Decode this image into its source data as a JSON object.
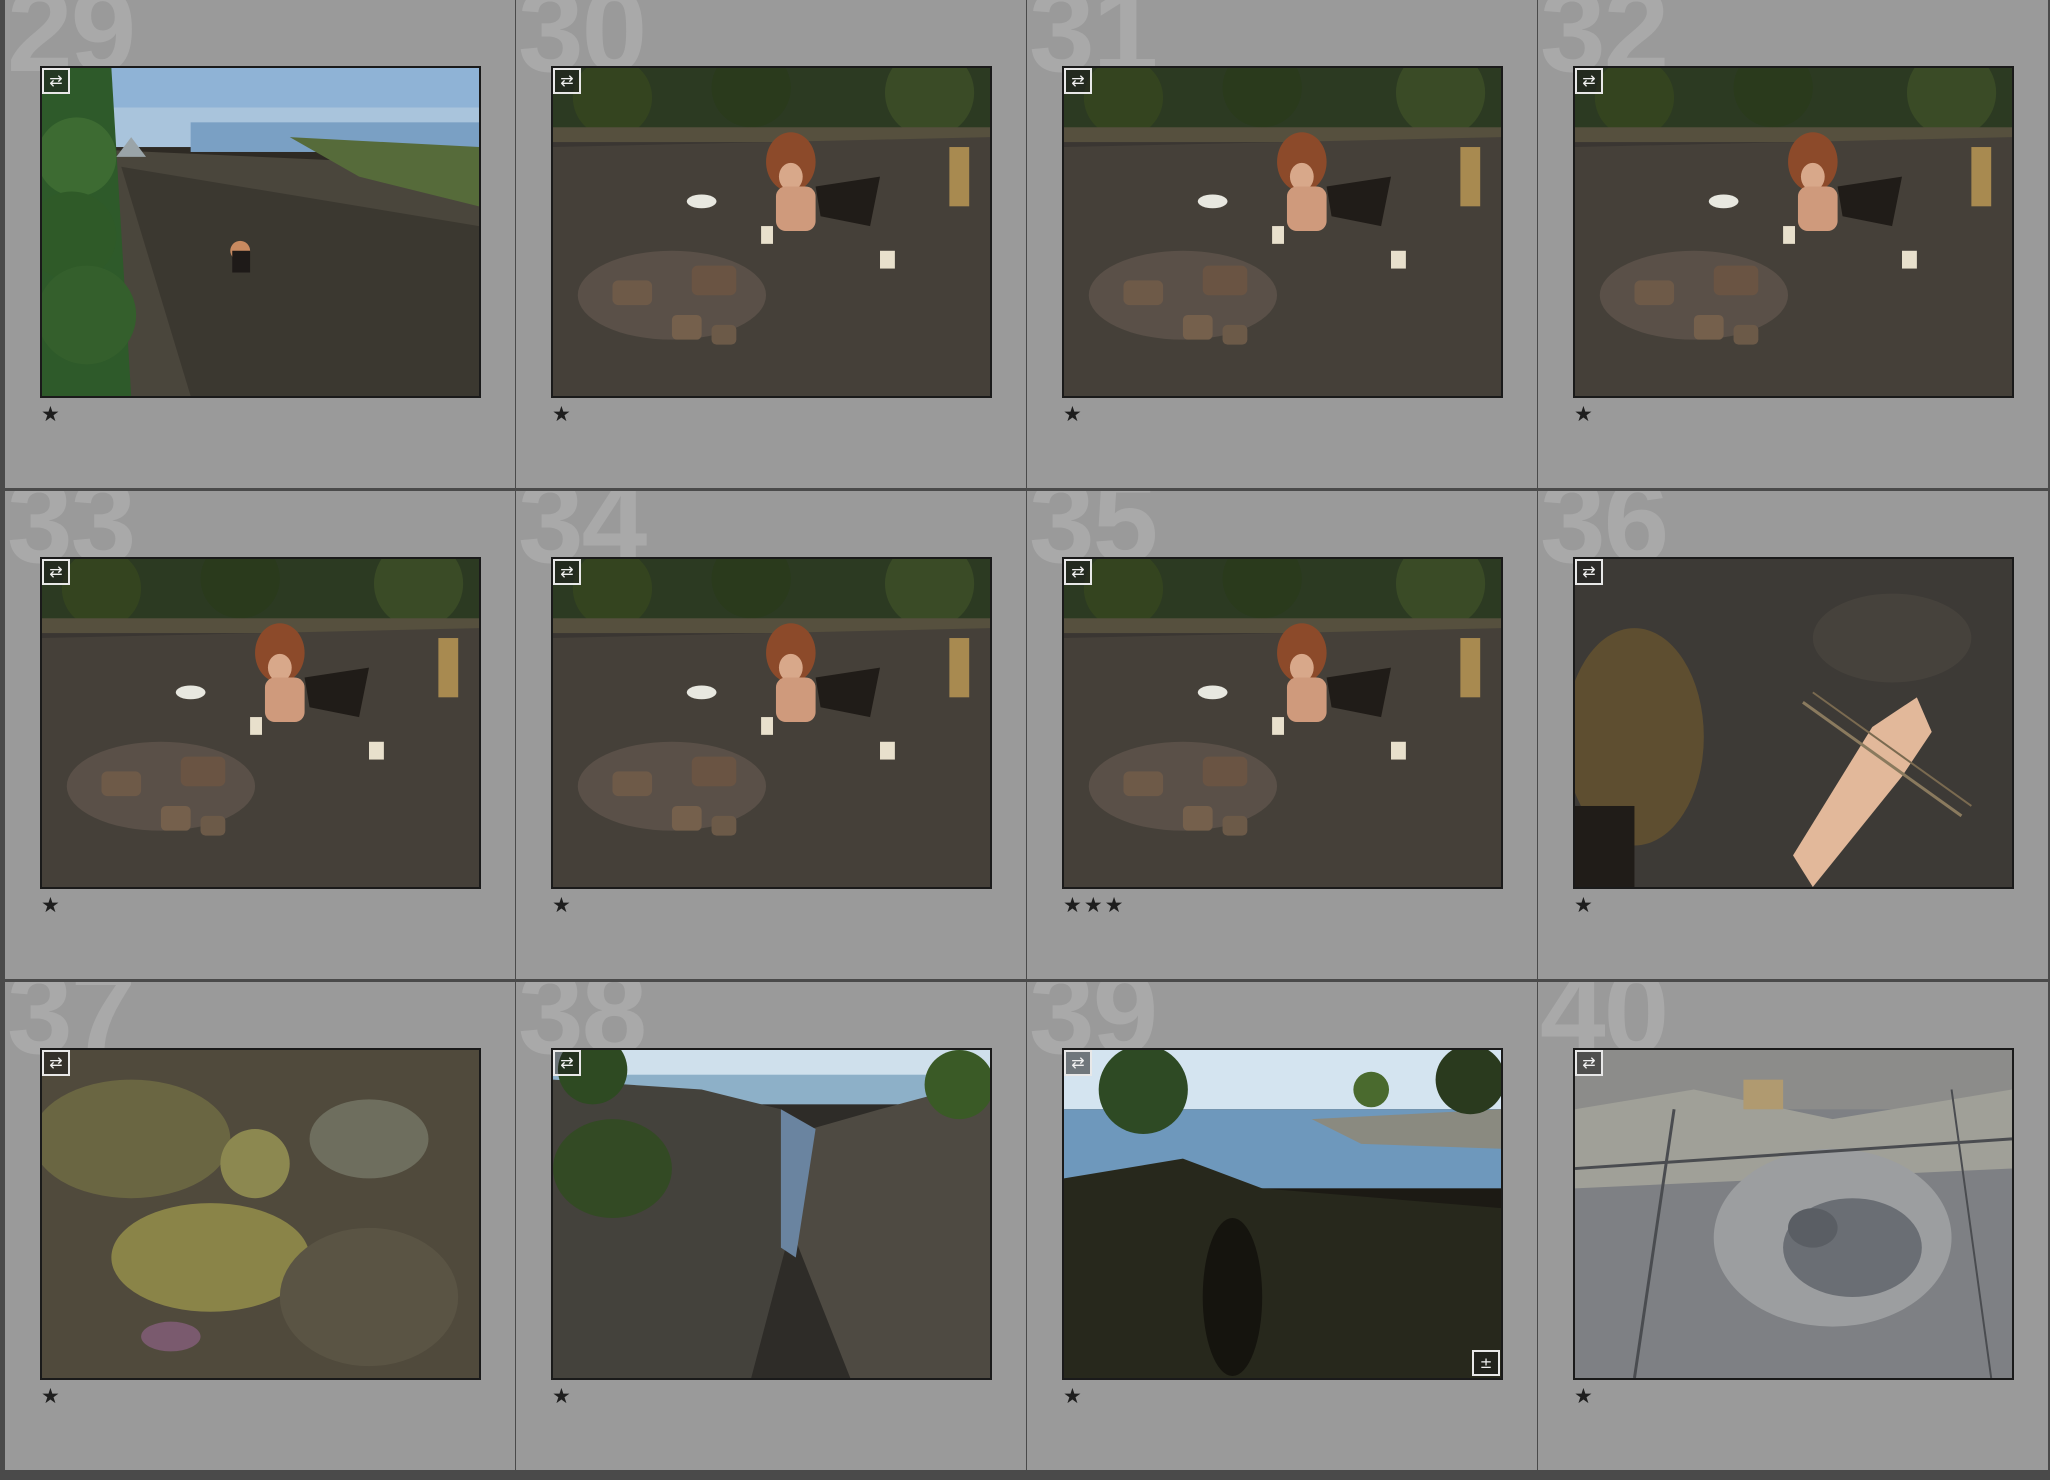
{
  "grid": {
    "cells": [
      {
        "number": "29",
        "rating": "★",
        "sync_icon": "sync-settings-icon",
        "scene": "camp",
        "adjusted": false
      },
      {
        "number": "30",
        "rating": "★",
        "sync_icon": "sync-settings-icon",
        "scene": "fire",
        "adjusted": false
      },
      {
        "number": "31",
        "rating": "★",
        "sync_icon": "sync-settings-icon",
        "scene": "fire",
        "adjusted": false
      },
      {
        "number": "32",
        "rating": "★",
        "sync_icon": "sync-settings-icon",
        "scene": "fire",
        "adjusted": false
      },
      {
        "number": "33",
        "rating": "★",
        "sync_icon": "sync-settings-icon",
        "scene": "fire",
        "adjusted": false
      },
      {
        "number": "34",
        "rating": "★",
        "sync_icon": "sync-settings-icon",
        "scene": "fire",
        "adjusted": false
      },
      {
        "number": "35",
        "rating": "★★★",
        "sync_icon": "sync-settings-icon",
        "scene": "fire",
        "adjusted": false
      },
      {
        "number": "36",
        "rating": "★",
        "sync_icon": "sync-settings-icon",
        "scene": "hand",
        "adjusted": false
      },
      {
        "number": "37",
        "rating": "★",
        "sync_icon": "sync-settings-icon",
        "scene": "moss",
        "adjusted": false
      },
      {
        "number": "38",
        "rating": "★",
        "sync_icon": "sync-settings-icon",
        "scene": "crevice",
        "adjusted": false
      },
      {
        "number": "39",
        "rating": "★",
        "sync_icon": "sync-settings-icon",
        "scene": "bay",
        "adjusted": true
      },
      {
        "number": "40",
        "rating": "★",
        "sync_icon": "sync-settings-icon",
        "scene": "rock",
        "adjusted": false
      }
    ]
  },
  "colors": {
    "cell_bg": "#9a9a9a",
    "grid_line": "#4a4a4a",
    "number_watermark": "#a9a9a9",
    "thumb_border": "#1a1a1a",
    "star": "#1e1e1e"
  }
}
